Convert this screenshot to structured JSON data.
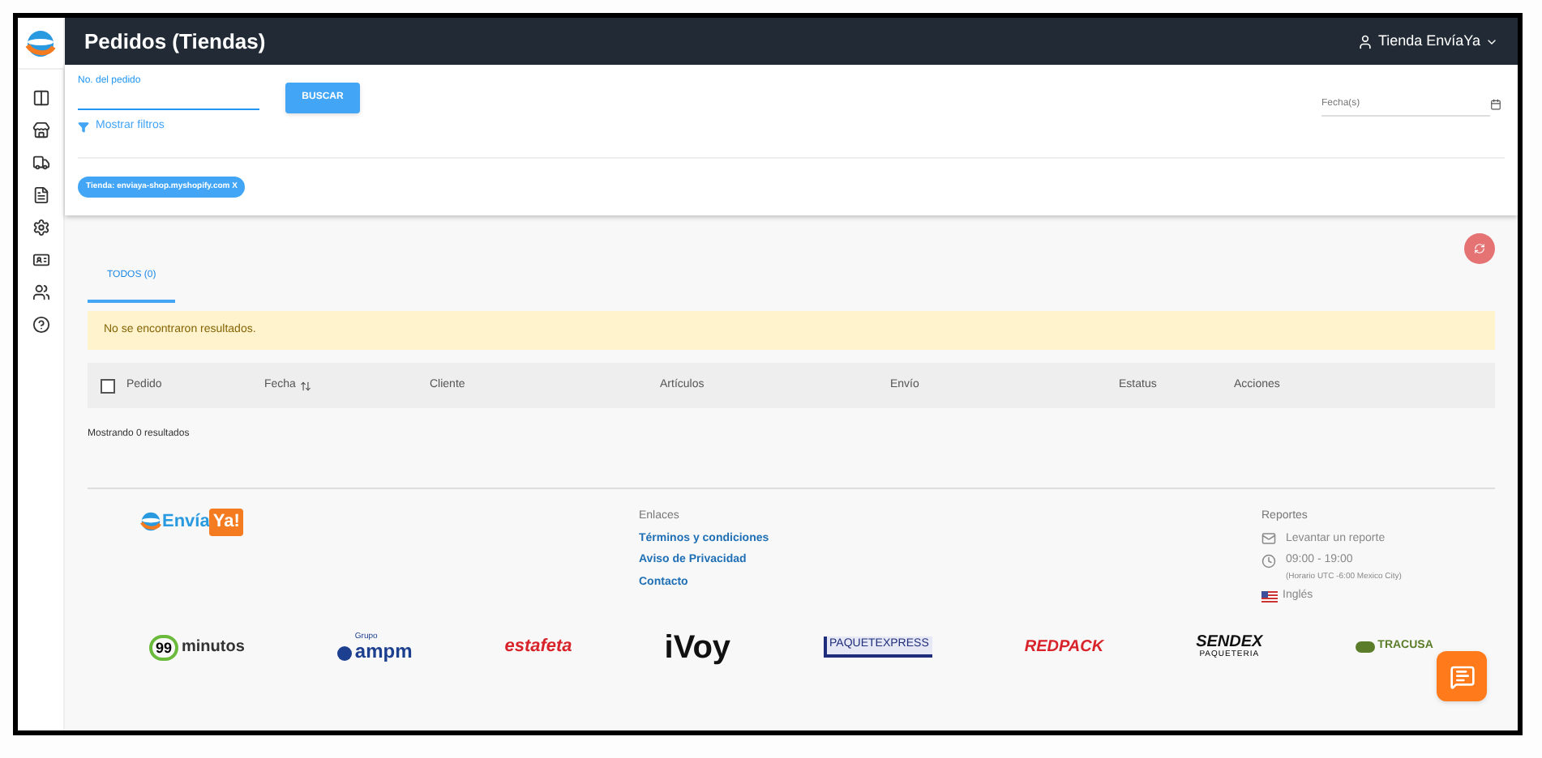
{
  "header": {
    "title": "Pedidos (Tiendas)",
    "user": "Tienda EnvíaYa"
  },
  "filters": {
    "order_field": {
      "label": "No. del pedido"
    },
    "search_button": "BUSCAR",
    "show_filters": "Mostrar filtros",
    "date_field": {
      "placeholder": "Fecha(s)"
    },
    "chips": [
      {
        "label": "Tienda: enviaya-shop.myshopify.com",
        "close": "X"
      }
    ]
  },
  "tabs": [
    {
      "label": "TODOS (0)",
      "selected": true
    }
  ],
  "alert": "No se encontraron resultados.",
  "table": {
    "select_all_checked": false,
    "columns": [
      "Pedido",
      "Fecha",
      "Cliente",
      "Artículos",
      "Envío",
      "Estatus",
      "Acciones"
    ]
  },
  "results_count": "Mostrando 0 resultados",
  "footer": {
    "logo": {
      "part1": "Envía",
      "part2": "Ya!"
    },
    "links_title": "Enlaces",
    "links": [
      "Términos y condiciones",
      "Aviso de Privacidad",
      "Contacto"
    ],
    "reports_title": "Reportes",
    "report_link": "Levantar un reporte",
    "hours": "09:00 - 19:00",
    "timezone": "(Horario UTC -6:00 Mexico City)",
    "language": "Inglés"
  },
  "carriers": [
    {
      "kind": "minutos",
      "text": "minutos",
      "badge": "99"
    },
    {
      "kind": "ampm",
      "text": "ampm",
      "badge": "Grupo"
    },
    {
      "kind": "estafeta",
      "text": "estafeta"
    },
    {
      "kind": "ivoy",
      "text": "iVoy"
    },
    {
      "kind": "paquetexpress",
      "text": "PAQUETEXPRESS"
    },
    {
      "kind": "redpack",
      "text": "REDPACK"
    },
    {
      "kind": "sendex",
      "text": "SENDEX",
      "badge": "PAQUETERIA"
    },
    {
      "kind": "tracusa",
      "text": "TRACUSA"
    }
  ]
}
